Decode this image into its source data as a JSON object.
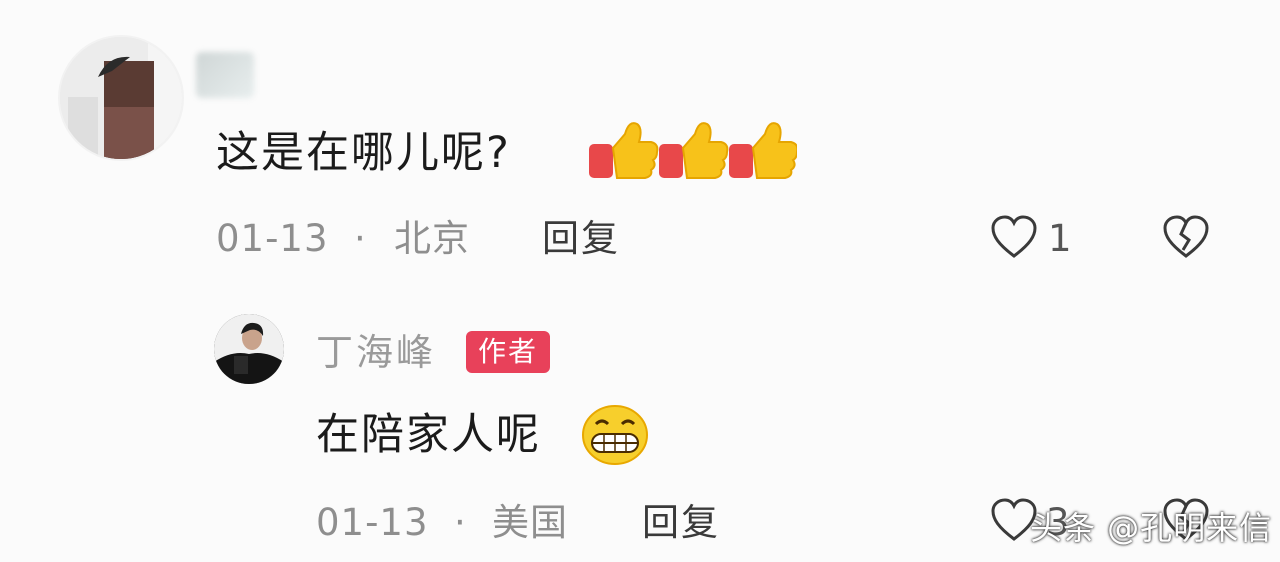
{
  "comment1": {
    "text": "这是在哪儿呢?",
    "emoji_icons": [
      "thumbs-up-icon",
      "thumbs-up-icon",
      "thumbs-up-icon"
    ],
    "date": "01-13",
    "separator": "·",
    "location": "北京",
    "reply_label": "回复",
    "like_count": "1"
  },
  "comment2": {
    "author": "丁海峰",
    "badge": "作者",
    "text": "在陪家人呢",
    "emoji_icon": "grinning-face-icon",
    "date": "01-13",
    "separator": "·",
    "location": "美国",
    "reply_label": "回复",
    "like_count": "3"
  },
  "watermark": {
    "text": "头条 @孔明来信"
  },
  "colors": {
    "background": "#fbfbfb",
    "badge": "#e8415a",
    "meta_text": "#8e8e8e",
    "thumb_yellow": "#f7c21a",
    "sleeve_red": "#e8484a"
  }
}
